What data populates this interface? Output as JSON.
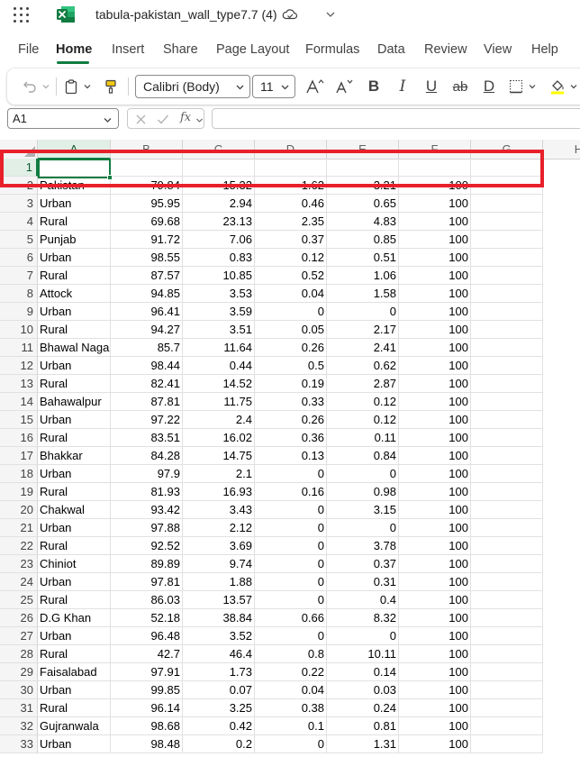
{
  "window": {
    "title": "tabula-pakistan_wall_type7.7 (4)",
    "app_icon": "excel-logo",
    "sync_icon": "cloud-check-icon",
    "accent": "#107c41"
  },
  "menu": {
    "tabs": [
      {
        "label": "File"
      },
      {
        "label": "Home"
      },
      {
        "label": "Insert"
      },
      {
        "label": "Share"
      },
      {
        "label": "Page Layout"
      },
      {
        "label": "Formulas"
      },
      {
        "label": "Data"
      },
      {
        "label": "Review"
      },
      {
        "label": "View"
      },
      {
        "label": "Help"
      }
    ],
    "active": "Home"
  },
  "ribbon": {
    "font_name": "Calibri (Body)",
    "font_size": "11",
    "bold_label": "B",
    "italic_label": "I",
    "underline_label": "U",
    "strike_label": "ab",
    "double_underline_label": "D"
  },
  "formula_bar": {
    "name_box": "A1",
    "fx_label": "fx",
    "formula": ""
  },
  "grid": {
    "columns": [
      "A",
      "B",
      "C",
      "D",
      "E",
      "F",
      "G",
      "H"
    ],
    "selected_cell": "A1",
    "rows": [
      {
        "n": "1",
        "a": "",
        "b": "",
        "c": "",
        "d": "",
        "e": "",
        "f": ""
      },
      {
        "n": "2",
        "a": "Pakistan",
        "b": "79.84",
        "c": "15.32",
        "d": "1.62",
        "e": "3.21",
        "f": "100"
      },
      {
        "n": "3",
        "a": "Urban",
        "b": "95.95",
        "c": "2.94",
        "d": "0.46",
        "e": "0.65",
        "f": "100"
      },
      {
        "n": "4",
        "a": "Rural",
        "b": "69.68",
        "c": "23.13",
        "d": "2.35",
        "e": "4.83",
        "f": "100"
      },
      {
        "n": "5",
        "a": "Punjab",
        "b": "91.72",
        "c": "7.06",
        "d": "0.37",
        "e": "0.85",
        "f": "100"
      },
      {
        "n": "6",
        "a": "Urban",
        "b": "98.55",
        "c": "0.83",
        "d": "0.12",
        "e": "0.51",
        "f": "100"
      },
      {
        "n": "7",
        "a": "Rural",
        "b": "87.57",
        "c": "10.85",
        "d": "0.52",
        "e": "1.06",
        "f": "100"
      },
      {
        "n": "8",
        "a": "Attock",
        "b": "94.85",
        "c": "3.53",
        "d": "0.04",
        "e": "1.58",
        "f": "100"
      },
      {
        "n": "9",
        "a": "Urban",
        "b": "96.41",
        "c": "3.59",
        "d": "0",
        "e": "0",
        "f": "100"
      },
      {
        "n": "10",
        "a": "Rural",
        "b": "94.27",
        "c": "3.51",
        "d": "0.05",
        "e": "2.17",
        "f": "100"
      },
      {
        "n": "11",
        "a": "Bhawal Naga",
        "b": "85.7",
        "c": "11.64",
        "d": "0.26",
        "e": "2.41",
        "f": "100"
      },
      {
        "n": "12",
        "a": "Urban",
        "b": "98.44",
        "c": "0.44",
        "d": "0.5",
        "e": "0.62",
        "f": "100"
      },
      {
        "n": "13",
        "a": "Rural",
        "b": "82.41",
        "c": "14.52",
        "d": "0.19",
        "e": "2.87",
        "f": "100"
      },
      {
        "n": "14",
        "a": "Bahawalpur",
        "b": "87.81",
        "c": "11.75",
        "d": "0.33",
        "e": "0.12",
        "f": "100"
      },
      {
        "n": "15",
        "a": "Urban",
        "b": "97.22",
        "c": "2.4",
        "d": "0.26",
        "e": "0.12",
        "f": "100"
      },
      {
        "n": "16",
        "a": "Rural",
        "b": "83.51",
        "c": "16.02",
        "d": "0.36",
        "e": "0.11",
        "f": "100"
      },
      {
        "n": "17",
        "a": "Bhakkar",
        "b": "84.28",
        "c": "14.75",
        "d": "0.13",
        "e": "0.84",
        "f": "100"
      },
      {
        "n": "18",
        "a": "Urban",
        "b": "97.9",
        "c": "2.1",
        "d": "0",
        "e": "0",
        "f": "100"
      },
      {
        "n": "19",
        "a": "Rural",
        "b": "81.93",
        "c": "16.93",
        "d": "0.16",
        "e": "0.98",
        "f": "100"
      },
      {
        "n": "20",
        "a": "Chakwal",
        "b": "93.42",
        "c": "3.43",
        "d": "0",
        "e": "3.15",
        "f": "100"
      },
      {
        "n": "21",
        "a": "Urban",
        "b": "97.88",
        "c": "2.12",
        "d": "0",
        "e": "0",
        "f": "100"
      },
      {
        "n": "22",
        "a": "Rural",
        "b": "92.52",
        "c": "3.69",
        "d": "0",
        "e": "3.78",
        "f": "100"
      },
      {
        "n": "23",
        "a": "Chiniot",
        "b": "89.89",
        "c": "9.74",
        "d": "0",
        "e": "0.37",
        "f": "100"
      },
      {
        "n": "24",
        "a": "Urban",
        "b": "97.81",
        "c": "1.88",
        "d": "0",
        "e": "0.31",
        "f": "100"
      },
      {
        "n": "25",
        "a": "Rural",
        "b": "86.03",
        "c": "13.57",
        "d": "0",
        "e": "0.4",
        "f": "100"
      },
      {
        "n": "26",
        "a": "D.G Khan",
        "b": "52.18",
        "c": "38.84",
        "d": "0.66",
        "e": "8.32",
        "f": "100"
      },
      {
        "n": "27",
        "a": "Urban",
        "b": "96.48",
        "c": "3.52",
        "d": "0",
        "e": "0",
        "f": "100"
      },
      {
        "n": "28",
        "a": "Rural",
        "b": "42.7",
        "c": "46.4",
        "d": "0.8",
        "e": "10.11",
        "f": "100"
      },
      {
        "n": "29",
        "a": "Faisalabad",
        "b": "97.91",
        "c": "1.73",
        "d": "0.22",
        "e": "0.14",
        "f": "100"
      },
      {
        "n": "30",
        "a": "Urban",
        "b": "99.85",
        "c": "0.07",
        "d": "0.04",
        "e": "0.03",
        "f": "100"
      },
      {
        "n": "31",
        "a": "Rural",
        "b": "96.14",
        "c": "3.25",
        "d": "0.38",
        "e": "0.24",
        "f": "100"
      },
      {
        "n": "32",
        "a": "Gujranwala",
        "b": "98.68",
        "c": "0.42",
        "d": "0.1",
        "e": "0.81",
        "f": "100"
      },
      {
        "n": "33",
        "a": "Urban",
        "b": "98.48",
        "c": "0.2",
        "d": "0",
        "e": "1.31",
        "f": "100"
      }
    ]
  },
  "annotation": {
    "color": "#e8202a"
  }
}
